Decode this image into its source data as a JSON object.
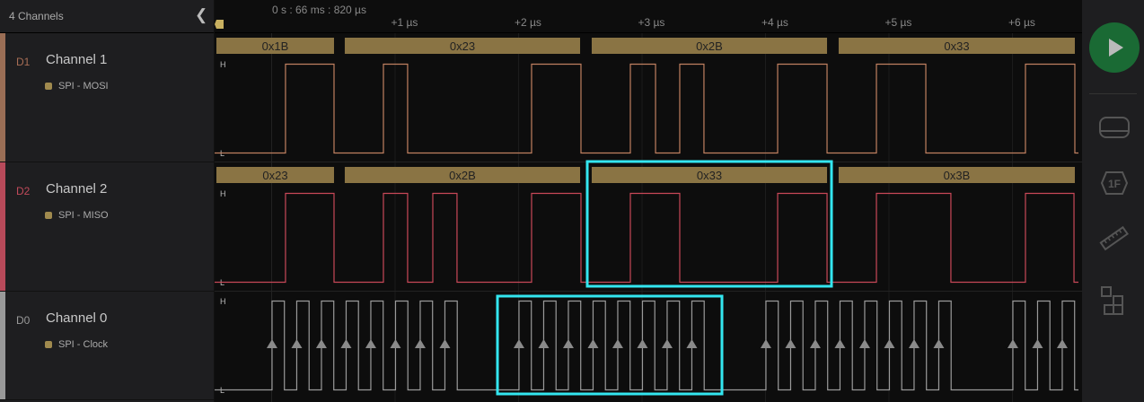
{
  "header": {
    "title": "4 Channels",
    "collapse_icon": "chevron-left-icon",
    "time_reference": "0 s : 66 ms : 820 µs"
  },
  "timeline": {
    "tick_labels": [
      "+1 µs",
      "+2 µs",
      "+3 µs",
      "+4 µs",
      "+5 µs",
      "+6 µs"
    ],
    "ticks_us": [
      1,
      2,
      3,
      4,
      5,
      6
    ]
  },
  "channels": [
    {
      "id": "D1",
      "name": "Channel 1",
      "analyzer": "SPI - MOSI",
      "color": "#b07a5a",
      "trace_color": "#c08060",
      "high": "H",
      "low": "L",
      "edges_us": [
        0.116,
        0.509,
        0.909,
        1.105,
        2.109,
        2.509,
        2.909,
        3.113,
        3.309,
        3.505,
        4.102,
        4.502,
        4.902,
        5.302,
        6.109,
        6.509
      ],
      "frames": [
        {
          "value": "0x1B",
          "start": -0.5,
          "end": 0.509
        },
        {
          "value": "0x23",
          "start": 0.596,
          "end": 2.502
        },
        {
          "value": "0x2B",
          "start": 2.596,
          "end": 4.502
        },
        {
          "value": "0x33",
          "start": 4.596,
          "end": 6.509
        }
      ]
    },
    {
      "id": "D2",
      "name": "Channel 2",
      "analyzer": "SPI - MISO",
      "color": "#c04a5a",
      "trace_color": "#c84858",
      "high": "H",
      "low": "L",
      "edges_us": [
        0.116,
        0.509,
        0.909,
        1.105,
        1.309,
        1.505,
        2.109,
        2.509,
        2.909,
        3.309,
        4.102,
        4.502,
        4.902,
        5.505,
        6.109,
        6.502
      ],
      "frames": [
        {
          "value": "0x23",
          "start": -0.5,
          "end": 0.509
        },
        {
          "value": "0x2B",
          "start": 0.596,
          "end": 2.502
        },
        {
          "value": "0x33",
          "start": 2.596,
          "end": 4.502
        },
        {
          "value": "0x3B",
          "start": 4.596,
          "end": 6.509
        }
      ]
    },
    {
      "id": "D0",
      "name": "Channel 0",
      "analyzer": "SPI - Clock",
      "color": "#9a9a9a",
      "trace_color": "#9a9a9a",
      "high": "H",
      "low": "L",
      "clock": {
        "burst_starts_us": [
          0.007,
          2.007,
          4.007,
          6.007
        ],
        "pulses": 8,
        "period_us": 0.2,
        "high_us": 0.1
      }
    }
  ],
  "sidebar": {
    "play_icon": "play-icon",
    "items": [
      "analyzers-icon",
      "measurements-icon",
      "timing-markers-icon",
      "extensions-icon"
    ]
  },
  "colors": {
    "frame_bar": "#8a7444",
    "highlight": "#33e6f0",
    "run_button": "#1a6a34"
  }
}
